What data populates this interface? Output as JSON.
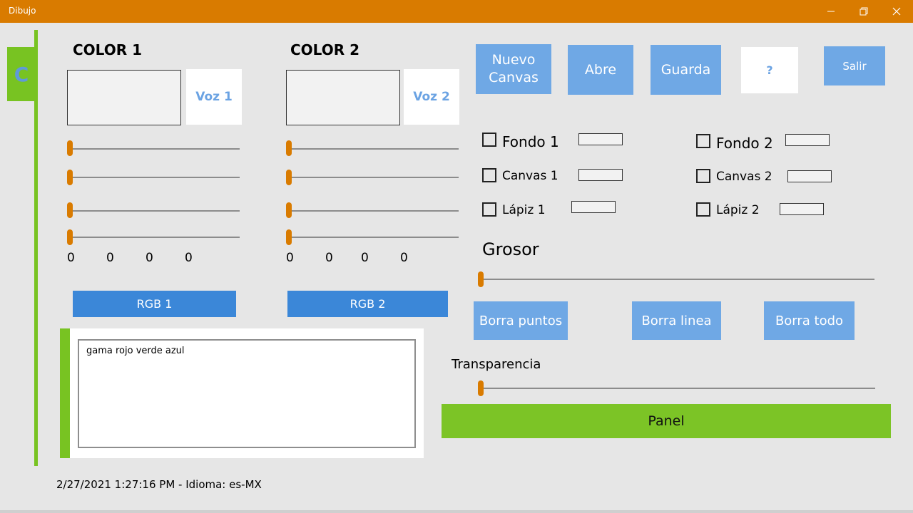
{
  "window": {
    "title": "Dibujo"
  },
  "colors": {
    "accent": "#d97b00",
    "green": "#78c322",
    "blue": "#3b87d8",
    "light_blue": "#6fa8e5"
  },
  "color1": {
    "heading": "COLOR 1",
    "voz_label": "Voz 1",
    "values": [
      "0",
      "0",
      "0",
      "0"
    ],
    "sliders": [
      0,
      0,
      0,
      0
    ],
    "rgb_label": "RGB 1"
  },
  "color2": {
    "heading": "COLOR 2",
    "voz_label": "Voz 2",
    "values": [
      "0",
      "0",
      "0",
      "0"
    ],
    "sliders": [
      0,
      0,
      0,
      0
    ],
    "rgb_label": "RGB 2"
  },
  "toolbar": {
    "nuevo_canvas": "Nuevo Canvas",
    "abre": "Abre",
    "guarda": "Guarda",
    "help": "?",
    "salir": "Salir"
  },
  "checkboxes": {
    "fondo1": "Fondo 1",
    "canvas1": "Canvas 1",
    "lapiz1": "Lápiz 1",
    "fondo2": "Fondo 2",
    "canvas2": "Canvas 2",
    "lapiz2": "Lápiz 2"
  },
  "grosor": {
    "label": "Grosor",
    "value": 0
  },
  "erase": {
    "puntos": "Borra puntos",
    "linea": "Borra linea",
    "todo": "Borra todo"
  },
  "transparencia": {
    "label": "Transparencia",
    "value": 0
  },
  "text_area": {
    "value": "gama rojo verde azul"
  },
  "panel_button": "Panel",
  "status": "2/27/2021 1:27:16 PM - Idioma: es-MX"
}
